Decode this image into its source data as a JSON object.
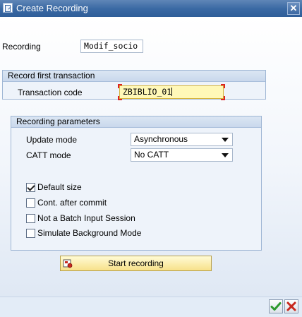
{
  "window": {
    "title": "Create Recording"
  },
  "recording": {
    "label": "Recording",
    "value": "Modif_socio"
  },
  "first_transaction": {
    "title": "Record first transaction",
    "tcode_label": "Transaction code",
    "tcode_value": "ZBIBLIO_01"
  },
  "params": {
    "title": "Recording parameters",
    "update_mode_label": "Update mode",
    "update_mode_value": "Asynchronous",
    "catt_mode_label": "CATT mode",
    "catt_mode_value": "No CATT",
    "checkboxes": [
      {
        "label": "Default size",
        "checked": true
      },
      {
        "label": "Cont. after commit",
        "checked": false
      },
      {
        "label": "Not a Batch Input Session",
        "checked": false
      },
      {
        "label": "Simulate Background Mode",
        "checked": false
      }
    ]
  },
  "start_button": {
    "label": "Start recording",
    "icon": "recording-icon"
  },
  "footer": {
    "ok_icon": "check-icon",
    "cancel_icon": "cancel-x-icon"
  },
  "colors": {
    "titlebar": "#3b6aa4",
    "focus_field": "#fff8b8",
    "button_yellow": "#f7e18a",
    "ok_green": "#2e9a2e",
    "cancel_red": "#c8281e"
  }
}
